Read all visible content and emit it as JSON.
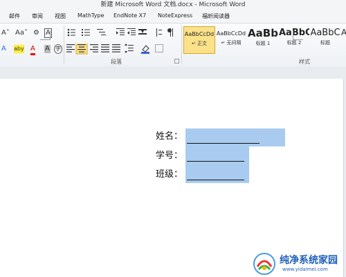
{
  "window": {
    "title": "新建 Microsoft Word 文档.docx - Microsoft Word"
  },
  "tabs": [
    "邮件",
    "审阅",
    "视图",
    "MathType",
    "EndNote X7",
    "NoteExpress",
    "福昕阅读器"
  ],
  "ribbon": {
    "groups": {
      "paragraph": "段落",
      "styles": "样式"
    },
    "font_row1": [
      "A˄",
      "Aa˅",
      "⚙",
      "A"
    ],
    "font_row2": [
      "A",
      "aby",
      "A",
      "A",
      "字"
    ],
    "styles": [
      {
        "sample": "AaBbCcDd",
        "name": "↵ 正文",
        "selected": true
      },
      {
        "sample": "AaBbCcDd",
        "name": "↵ 无间隔",
        "selected": false
      },
      {
        "sample": "AaBb",
        "name": "标题 1",
        "selected": false
      },
      {
        "sample": "AaBbC",
        "name": "标题 2",
        "selected": false
      },
      {
        "sample": "AaBbC",
        "name": "标题",
        "selected": false
      },
      {
        "sample": "A",
        "name": "",
        "selected": false
      }
    ]
  },
  "document": {
    "fields": [
      {
        "label": "姓名："
      },
      {
        "label": "学号："
      },
      {
        "label": "班级："
      }
    ]
  },
  "watermark": {
    "text": "纯净系统家园",
    "url": "www.yidaimei.com"
  },
  "colors": {
    "highlight": "#a9cbf0",
    "selected_style": "#fbe28a"
  }
}
